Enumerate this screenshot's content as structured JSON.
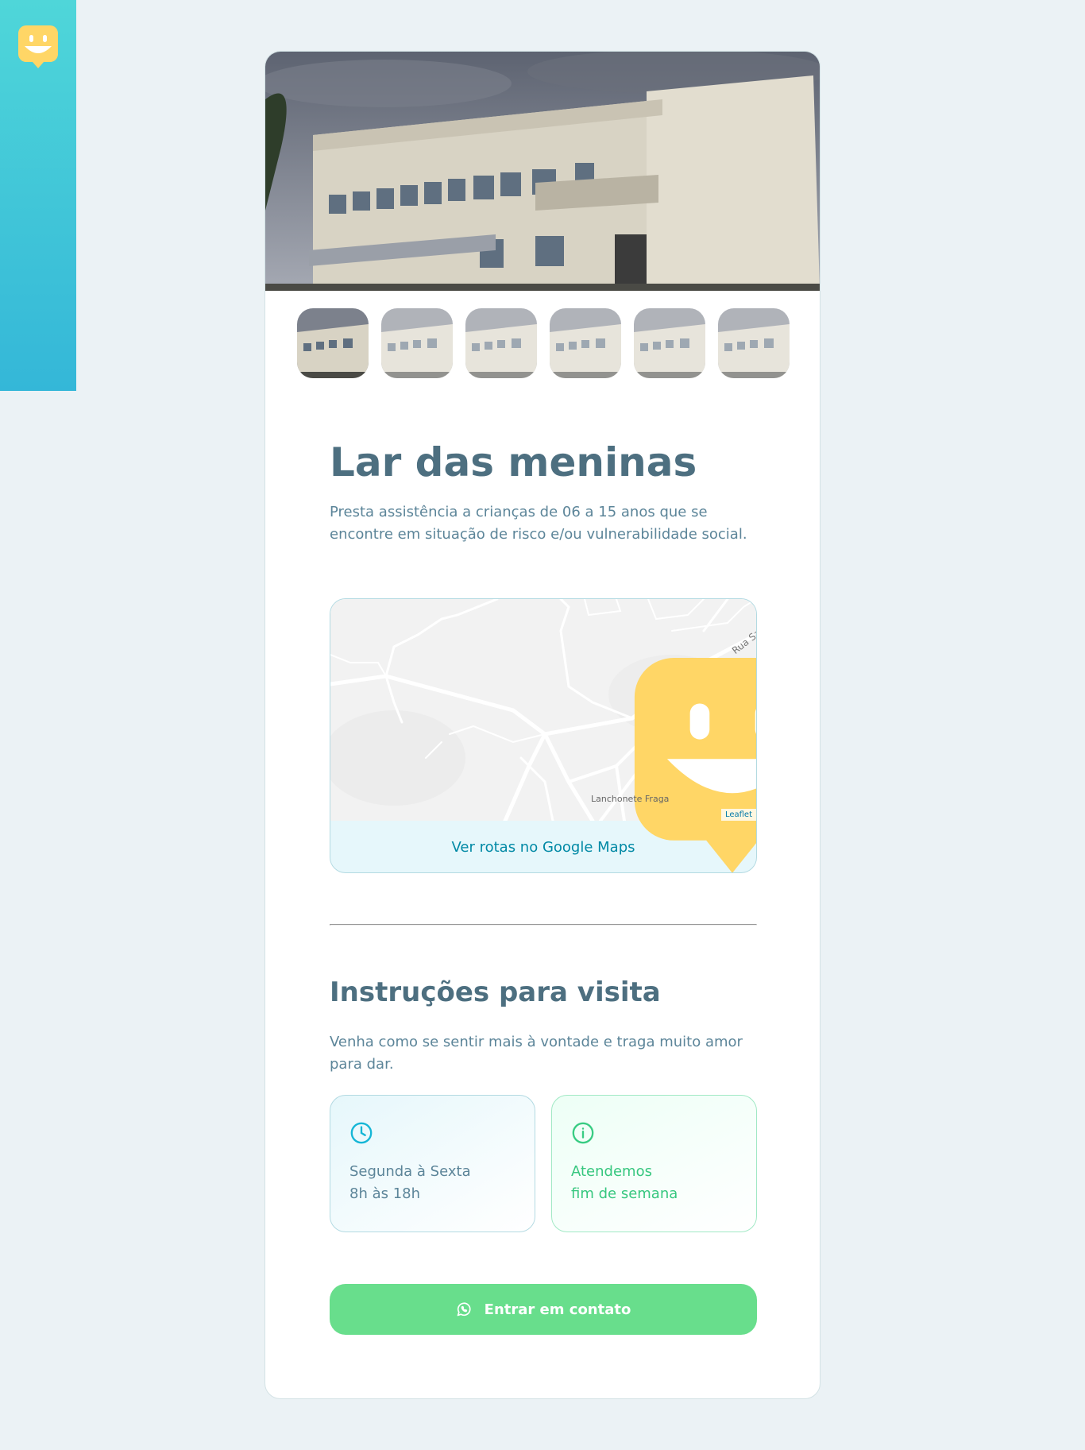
{
  "orphanage": {
    "name": "Lar das meninas",
    "about": "Presta assistência a crianças de 06 a 15 anos que se encontre em situação de risco e/ou vulnerabilidade social.",
    "images_count": 6
  },
  "map": {
    "street_label": "Rua Sa",
    "poi_label": "Lanchonete Fraga",
    "attribution": "Leaflet",
    "directions_link": "Ver rotas no Google Maps"
  },
  "visit": {
    "title": "Instruções para visita",
    "instructions": "Venha como se sentir mais à vontade e traga muito amor para dar.",
    "hours": {
      "icon": "clock-icon",
      "line1": "Segunda à Sexta",
      "line2": "8h às 18h"
    },
    "weekend": {
      "icon": "info-icon",
      "line1": "Atendemos",
      "line2": "fim de semana"
    }
  },
  "contact": {
    "label": "Entrar em contato",
    "icon": "whatsapp-icon"
  },
  "colors": {
    "sidebar_top": "#4fd6d9",
    "sidebar_bottom": "#34b7d8",
    "title": "#4d6f80",
    "text": "#5c8599",
    "link": "#0089a5",
    "green": "#37c77f",
    "button": "#68de8c",
    "pin": "#ffd666"
  }
}
